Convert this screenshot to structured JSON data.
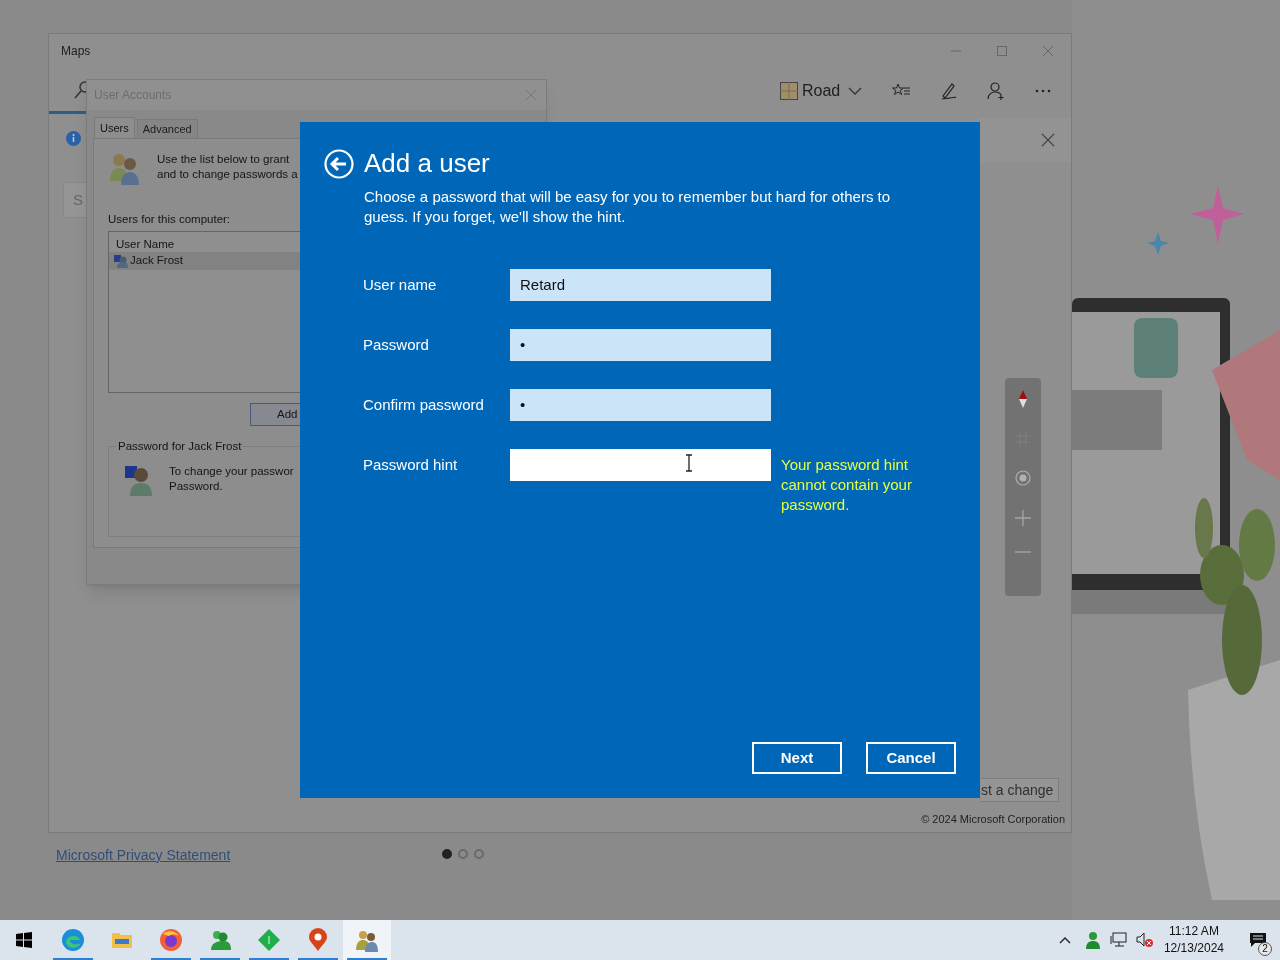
{
  "maps_window": {
    "title": "Maps",
    "map_style": "Road",
    "search_box": "S",
    "feedback_button": "st a change",
    "copyright": "© 2024 Microsoft Corporation"
  },
  "user_accounts": {
    "title": "User Accounts",
    "tabs": [
      {
        "label": "Users",
        "selected": true
      },
      {
        "label": "Advanced",
        "selected": false
      }
    ],
    "intro": [
      "Use the list below to grant",
      "and to change passwords a"
    ],
    "list_label": "Users for this computer:",
    "list": {
      "columns": [
        "User Name"
      ],
      "rows": [
        {
          "name": "Jack Frost",
          "selected": true
        }
      ]
    },
    "add_button": "Add",
    "password_group": {
      "title": "Password for Jack Frost",
      "text": [
        "To change your passwor",
        "Password."
      ]
    }
  },
  "dialog": {
    "title": "Add a user",
    "description": "Choose a password that will be easy for you to remember but hard for others to guess. If you forget, we'll show the hint.",
    "fields": [
      {
        "label": "User name",
        "value": "Retard",
        "focused": false
      },
      {
        "label": "Password",
        "value": "•",
        "focused": false
      },
      {
        "label": "Confirm password",
        "value": "•",
        "focused": false
      },
      {
        "label": "Password hint",
        "focused": true,
        "error": "Your password hint cannot contain your password."
      }
    ],
    "buttons": [
      "Next",
      "Cancel"
    ]
  },
  "privacy_link": "Microsoft Privacy Statement",
  "pages": [
    {
      "selected": true
    },
    {
      "selected": false
    },
    {
      "selected": false
    }
  ],
  "taskbar": {
    "apps": [
      {
        "kind": "edge",
        "running": true,
        "active": false
      },
      {
        "kind": "folder",
        "running": false,
        "active": false
      },
      {
        "kind": "firefox",
        "running": true,
        "active": false
      },
      {
        "kind": "people",
        "running": true,
        "active": false
      },
      {
        "kind": "diamond",
        "running": true,
        "active": false
      },
      {
        "kind": "pin",
        "running": true,
        "active": false
      },
      {
        "kind": "users",
        "running": true,
        "active": true
      }
    ],
    "time": "11:12 AM",
    "date": "12/13/2024",
    "notifications": "2"
  }
}
